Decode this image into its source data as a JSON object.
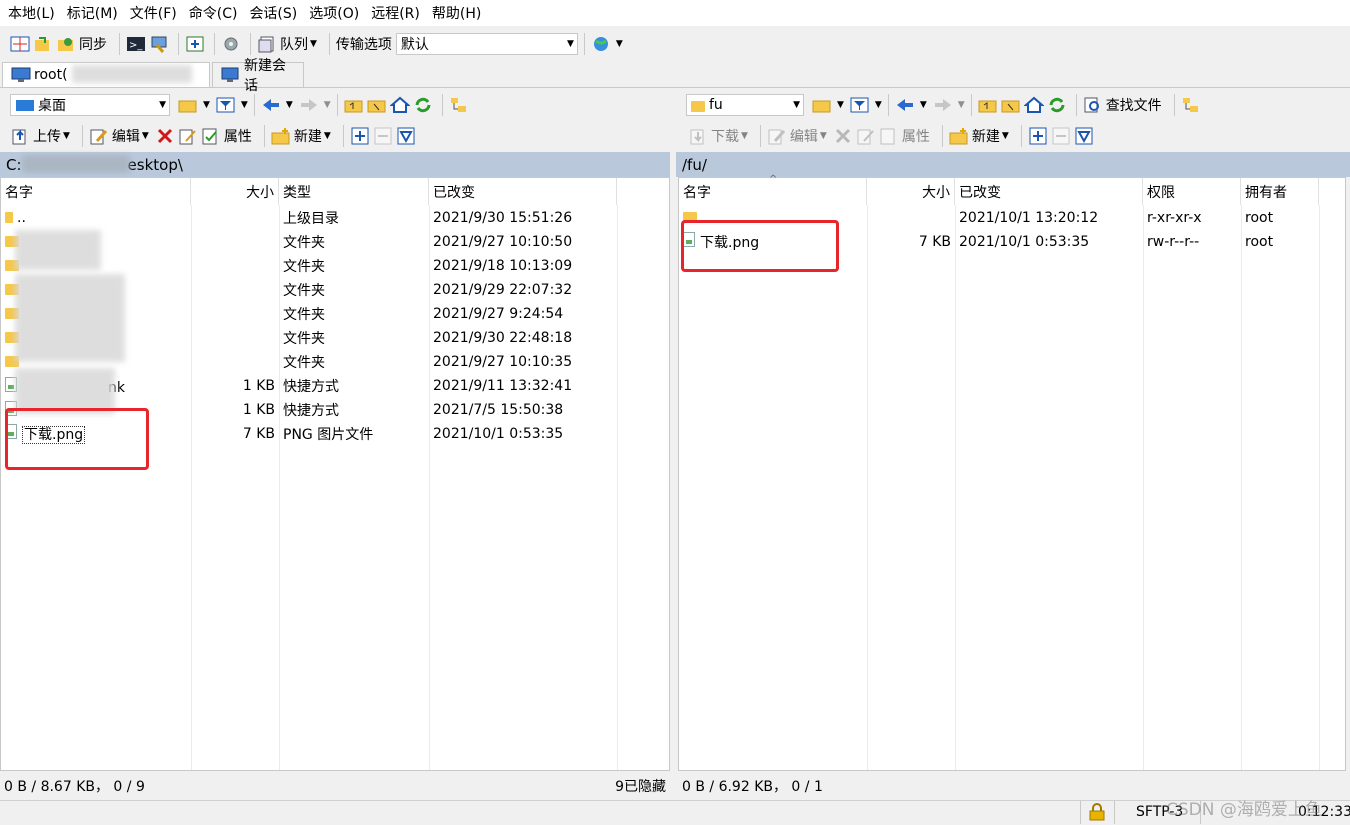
{
  "menu": [
    "本地(L)",
    "标记(M)",
    "文件(F)",
    "命令(C)",
    "会话(S)",
    "选项(O)",
    "远程(R)",
    "帮助(H)"
  ],
  "toolbar": {
    "sync_label": "同步",
    "queue_label": "队列",
    "transfer_label": "传输选项",
    "transfer_value": "默认"
  },
  "tabs": {
    "session": "root(",
    "new_session": "新建会话"
  },
  "left": {
    "location": "桌面",
    "upload": "上传",
    "edit": "编辑",
    "props": "属性",
    "new": "新建",
    "path_start": "C:",
    "path_end": "esktop\\",
    "columns": [
      "名字",
      "大小",
      "类型",
      "已改变"
    ],
    "rows": [
      {
        "name": "..",
        "size": "",
        "type": "上级目录",
        "date": "2021/9/30  15:51:26"
      },
      {
        "name": "",
        "size": "",
        "type": "文件夹",
        "date": "2021/9/27  10:10:50"
      },
      {
        "name": "",
        "size": "",
        "type": "文件夹",
        "date": "2021/9/18  10:13:09"
      },
      {
        "name": "",
        "size": "",
        "type": "文件夹",
        "date": "2021/9/29  22:07:32"
      },
      {
        "name": "",
        "size": "",
        "type": "文件夹",
        "date": "2021/9/27  9:24:54"
      },
      {
        "name": "",
        "size": "",
        "type": "文件夹",
        "date": "2021/9/30  22:48:18"
      },
      {
        "name": "",
        "size": "",
        "type": "文件夹",
        "date": "2021/9/27  10:10:35"
      },
      {
        "name": "nk",
        "size": "1 KB",
        "type": "快捷方式",
        "date": "2021/9/11  13:32:41"
      },
      {
        "name": "",
        "size": "1 KB",
        "type": "快捷方式",
        "date": "2021/7/5  15:50:38"
      },
      {
        "name": "下载.png",
        "size": "7 KB",
        "type": "PNG 图片文件",
        "date": "2021/10/1  0:53:35"
      }
    ],
    "status": "0 B / 8.67 KB， 0 / 9",
    "hidden": "9已隐藏"
  },
  "right": {
    "location": "fu",
    "download": "下载",
    "edit": "编辑",
    "props": "属性",
    "new": "新建",
    "find": "查找文件",
    "path": "/fu/",
    "columns": [
      "名字",
      "大小",
      "已改变",
      "权限",
      "拥有者"
    ],
    "rows": [
      {
        "name": "..",
        "size": "",
        "date": "2021/10/1 13:20:12",
        "perm": "r-xr-xr-x",
        "owner": "root"
      },
      {
        "name": "下载.png",
        "size": "7 KB",
        "date": "2021/10/1 0:53:35",
        "perm": "rw-r--r--",
        "owner": "root"
      }
    ],
    "status": "0 B / 6.92 KB， 0 / 1"
  },
  "bottom": {
    "protocol": "SFTP-3",
    "time": "0:12:33",
    "watermark": "CSDN @海鸥爱上鱼"
  },
  "colors": {
    "pathbar": "#b9c9db",
    "highlight": "#e8252b"
  }
}
